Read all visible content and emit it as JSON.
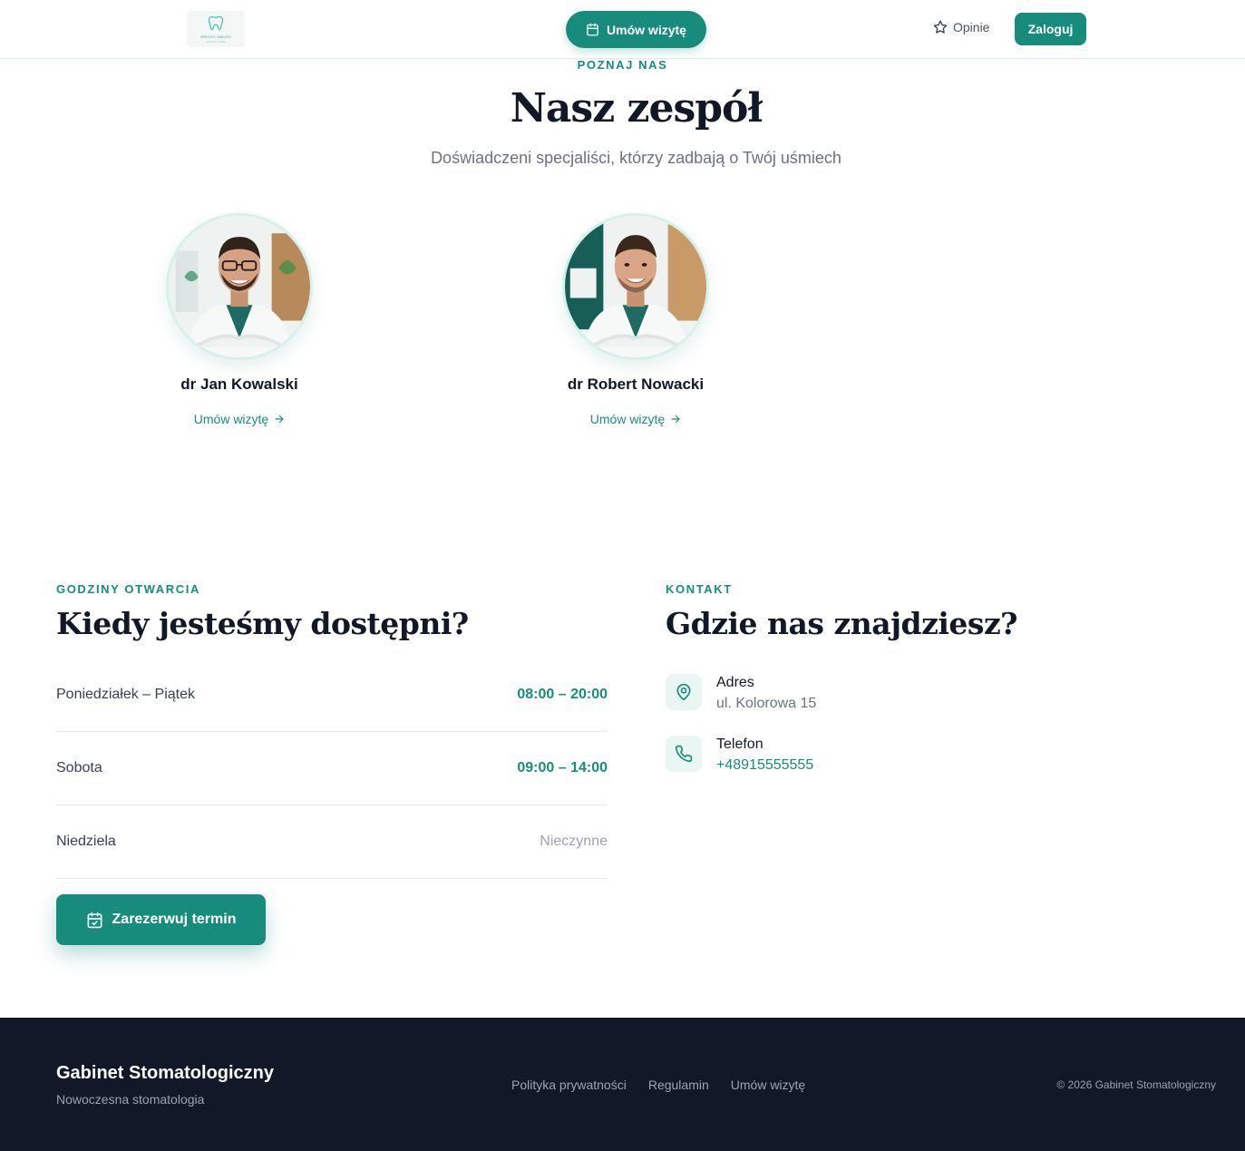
{
  "header": {
    "logo_text": "BRIGHT SMILES",
    "logo_sub": "DENTAL CARE",
    "book_label": "Umów wizytę",
    "reviews_label": "Opinie",
    "login_label": "Zaloguj"
  },
  "team": {
    "eyebrow": "POZNAJ NAS",
    "title": "Nasz zespół",
    "subtitle": "Doświadczeni specjaliści, którzy zadbają o Twój uśmiech",
    "doctors": [
      {
        "name": "dr Jan Kowalski",
        "link": "Umów wizytę"
      },
      {
        "name": "dr Robert Nowacki",
        "link": "Umów wizytę"
      }
    ]
  },
  "hours": {
    "eyebrow": "GODZINY OTWARCIA",
    "title": "Kiedy jesteśmy dostępni?",
    "rows": [
      {
        "day": "Poniedziałek – Piątek",
        "time": "08:00 – 20:00"
      },
      {
        "day": "Sobota",
        "time": "09:00 – 14:00"
      },
      {
        "day": "Niedziela",
        "time": "Nieczynne"
      }
    ],
    "reserve_label": "Zarezerwuj termin"
  },
  "contact": {
    "eyebrow": "KONTAKT",
    "title": "Gdzie nas znajdziesz?",
    "address_label": "Adres",
    "address_value": "ul. Kolorowa 15",
    "phone_label": "Telefon",
    "phone_value": "+48915555555"
  },
  "footer": {
    "brand": "Gabinet Stomatologiczny",
    "tagline": "Nowoczesna stomatologia",
    "links": [
      "Polityka prywatności",
      "Regulamin",
      "Umów wizytę"
    ],
    "copyright": "© 2026 Gabinet Stomatologiczny"
  },
  "colors": {
    "accent": "#178c7c",
    "dark": "#111827",
    "muted": "#6b7280"
  }
}
